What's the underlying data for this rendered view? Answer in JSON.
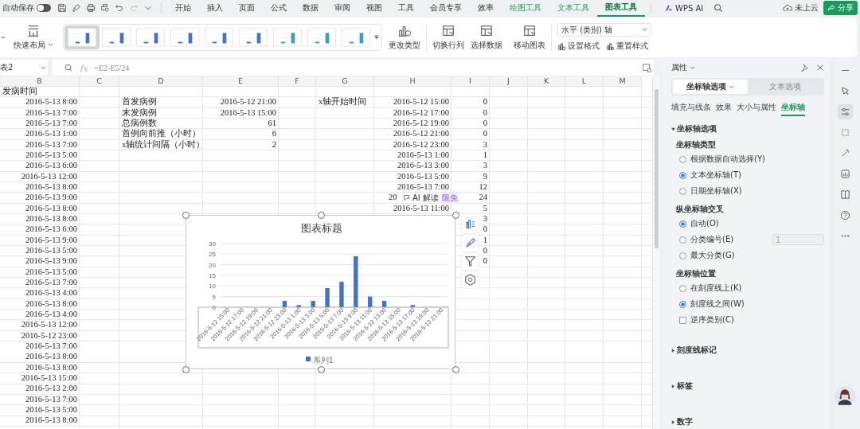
{
  "autosave": {
    "label": "自动保存",
    "on": false
  },
  "menu_tabs": [
    {
      "label": "开始",
      "kind": "normal",
      "selected": false
    },
    {
      "label": "插入",
      "kind": "normal",
      "selected": false
    },
    {
      "label": "页面",
      "kind": "normal",
      "selected": false
    },
    {
      "label": "公式",
      "kind": "normal",
      "selected": false
    },
    {
      "label": "数据",
      "kind": "normal",
      "selected": false
    },
    {
      "label": "审阅",
      "kind": "normal",
      "selected": false
    },
    {
      "label": "视图",
      "kind": "normal",
      "selected": false
    },
    {
      "label": "工具",
      "kind": "normal",
      "selected": false
    },
    {
      "label": "会员专享",
      "kind": "normal",
      "selected": false
    },
    {
      "label": "效率",
      "kind": "normal",
      "selected": false
    },
    {
      "label": "绘图工具",
      "kind": "context",
      "selected": false
    },
    {
      "label": "文本工具",
      "kind": "context",
      "selected": false
    },
    {
      "label": "图表工具",
      "kind": "context",
      "selected": true
    }
  ],
  "ai_tab": "WPS AI",
  "cloud": "未上云",
  "share": "分享",
  "ribbon": {
    "layout": "快速布局",
    "styles": [
      {
        "selected": true
      },
      {
        "selected": false
      },
      {
        "selected": false
      },
      {
        "selected": false
      },
      {
        "selected": false
      },
      {
        "selected": false
      },
      {
        "selected": false
      },
      {
        "selected": false
      },
      {
        "selected": false
      }
    ],
    "change_type": "更改类型",
    "buttons": [
      "切换行列",
      "选择数据",
      "移动图表"
    ],
    "element_select": "水平 (类别) 轴",
    "format": "设置格式",
    "reset": "重置样式"
  },
  "formula_bar": {
    "name_box": "表2",
    "fx_label": "fx",
    "formula": "=E2-E5/24"
  },
  "sheet": {
    "columns": [
      "B",
      "C",
      "D",
      "E",
      "F",
      "G",
      "H",
      "I",
      "J",
      "K",
      "L",
      "M"
    ],
    "rows": [
      {
        "B": {
          "text": "发病时间",
          "kind": "text"
        }
      },
      {
        "B": {
          "text": "2016-5-13 8:00",
          "kind": "number"
        },
        "D": {
          "text": "首发病例",
          "kind": "text"
        },
        "E": {
          "text": "2016-5-12 21:00",
          "kind": "number"
        },
        "G": {
          "text": "x轴开始时间",
          "kind": "text"
        },
        "H": {
          "text": "2016-5-12 15:00",
          "kind": "number"
        },
        "I": {
          "text": "0",
          "kind": "number"
        }
      },
      {
        "B": {
          "text": "2016-5-13 7:00",
          "kind": "number"
        },
        "D": {
          "text": "末发病例",
          "kind": "text"
        },
        "E": {
          "text": "2016-5-13 15:00",
          "kind": "number"
        },
        "H": {
          "text": "2016-5-12 17:00",
          "kind": "number"
        },
        "I": {
          "text": "0",
          "kind": "number"
        }
      },
      {
        "B": {
          "text": "2016-5-13 7:00",
          "kind": "number"
        },
        "D": {
          "text": "总病例数",
          "kind": "text"
        },
        "E": {
          "text": "61",
          "kind": "number"
        },
        "H": {
          "text": "2016-5-12 19:00",
          "kind": "number"
        },
        "I": {
          "text": "0",
          "kind": "number"
        }
      },
      {
        "B": {
          "text": "2016-5-13 1:00",
          "kind": "number"
        },
        "D": {
          "text": "首例向前推（小时）",
          "kind": "text"
        },
        "E": {
          "text": "6",
          "kind": "number"
        },
        "H": {
          "text": "2016-5-12 21:00",
          "kind": "number"
        },
        "I": {
          "text": "0",
          "kind": "number"
        }
      },
      {
        "B": {
          "text": "2016-5-13 7:00",
          "kind": "number"
        },
        "D": {
          "text": "x轴统计间隔（小时）",
          "kind": "text"
        },
        "E": {
          "text": "2",
          "kind": "number"
        },
        "H": {
          "text": "2016-5-12 23:00",
          "kind": "number"
        },
        "I": {
          "text": "3",
          "kind": "number"
        }
      },
      {
        "B": {
          "text": "2016-5-13 5:00",
          "kind": "number"
        },
        "H": {
          "text": "2016-5-13 1:00",
          "kind": "number"
        },
        "I": {
          "text": "1",
          "kind": "number"
        }
      },
      {
        "B": {
          "text": "2016-5-13 6:00",
          "kind": "number"
        },
        "H": {
          "text": "2016-5-13 3:00",
          "kind": "number"
        },
        "I": {
          "text": "3",
          "kind": "number"
        }
      },
      {
        "B": {
          "text": "2016-5-13 12:00",
          "kind": "number"
        },
        "H": {
          "text": "2016-5-13 5:00",
          "kind": "number"
        },
        "I": {
          "text": "9",
          "kind": "number"
        }
      },
      {
        "B": {
          "text": "2016-5-13 8:00",
          "kind": "number"
        },
        "H": {
          "text": "2016-5-13 7:00",
          "kind": "number"
        },
        "I": {
          "text": "12",
          "kind": "number"
        }
      },
      {
        "B": {
          "text": "2016-5-13 9:00",
          "kind": "number"
        },
        "H": {
          "text": "20",
          "kind": "covered"
        },
        "I": {
          "text": "24",
          "kind": "number"
        }
      },
      {
        "B": {
          "text": "2016-5-13 8:00",
          "kind": "number"
        },
        "H": {
          "text": "2016-5-13 11:00",
          "kind": "number"
        },
        "I": {
          "text": "5",
          "kind": "number"
        }
      },
      {
        "B": {
          "text": "2016-5-13 8:00",
          "kind": "number"
        },
        "I": {
          "text": "3",
          "kind": "number"
        }
      },
      {
        "B": {
          "text": "2016-5-13 6:00",
          "kind": "number"
        },
        "I": {
          "text": "0",
          "kind": "number"
        }
      },
      {
        "B": {
          "text": "2016-5-13 9:00",
          "kind": "number"
        },
        "I": {
          "text": "1",
          "kind": "number"
        }
      },
      {
        "B": {
          "text": "2016-5-13 5:00",
          "kind": "number"
        },
        "I": {
          "text": "0",
          "kind": "number"
        }
      },
      {
        "B": {
          "text": "2016-5-13 9:00",
          "kind": "number"
        },
        "I": {
          "text": "0",
          "kind": "number"
        }
      },
      {
        "B": {
          "text": "2016-5-13 5:00",
          "kind": "number"
        }
      },
      {
        "B": {
          "text": "2016-5-13 7:00",
          "kind": "number"
        }
      },
      {
        "B": {
          "text": "2016-5-13 4:00",
          "kind": "number"
        }
      },
      {
        "B": {
          "text": "2016-5-13 8:00",
          "kind": "number"
        }
      },
      {
        "B": {
          "text": "2016-5-13 4:00",
          "kind": "number"
        }
      },
      {
        "B": {
          "text": "2016-5-13 12:00",
          "kind": "number"
        }
      },
      {
        "B": {
          "text": "2016-5-12 23:00",
          "kind": "number"
        }
      },
      {
        "B": {
          "text": "2016-5-13 7:00",
          "kind": "number"
        }
      },
      {
        "B": {
          "text": "2016-5-13 8:00",
          "kind": "number"
        }
      },
      {
        "B": {
          "text": "2016-5-13 8:00",
          "kind": "number"
        }
      },
      {
        "B": {
          "text": "2016-5-13 15:00",
          "kind": "number"
        }
      },
      {
        "B": {
          "text": "2016-5-13 2:00",
          "kind": "number"
        }
      },
      {
        "B": {
          "text": "2016-5-13 7:00",
          "kind": "number"
        }
      },
      {
        "B": {
          "text": "2016-5-13 5:00",
          "kind": "number"
        }
      },
      {
        "B": {
          "text": "2016-5-13 8:00",
          "kind": "number"
        }
      }
    ]
  },
  "ai_popup": {
    "label": "AI 解读",
    "badge": "限免"
  },
  "chart": {
    "chart_data": {
      "type": "bar",
      "title": "图表标题",
      "categories": [
        "2016-5-12 15:00",
        "2016-5-12 17:00",
        "2016-5-12 19:00",
        "2016-5-12 21:00",
        "2016-5-12 23:00",
        "2016-5-13 1:00",
        "2016-5-13 3:00",
        "2016-5-13 5:00",
        "2016-5-13 7:00",
        "2016-5-13 9:00",
        "2016-5-13 11:00",
        "2016-5-13 13:00",
        "2016-5-13 15:00",
        "2016-5-13 17:00",
        "2016-5-13 19:00",
        "2016-5-13 21:00"
      ],
      "series": [
        {
          "name": "系列1",
          "color": "#4472c4",
          "values": [
            0,
            0,
            0,
            0,
            3,
            1,
            3,
            9,
            12,
            24,
            5,
            3,
            0,
            1,
            0,
            0
          ]
        }
      ],
      "ylim": [
        0,
        30
      ],
      "yticks": [
        0,
        5,
        10,
        15,
        20,
        25,
        30
      ],
      "grid": true
    }
  },
  "panel": {
    "title": "属性",
    "tabs": [
      {
        "label": "坐标轴选项",
        "selected": true
      },
      {
        "label": "文本选项",
        "selected": false
      }
    ],
    "subtabs": [
      {
        "label": "填充与线条",
        "selected": false
      },
      {
        "label": "效果",
        "selected": false
      },
      {
        "label": "大小与属性",
        "selected": false
      },
      {
        "label": "坐标轴",
        "selected": true
      }
    ],
    "section": {
      "title": "坐标轴选项",
      "expanded": true,
      "groups": [
        {
          "title": "坐标轴类型",
          "options": [
            {
              "kind": "radio",
              "label": "根据数据自动选择(Y)",
              "selected": false
            },
            {
              "kind": "radio",
              "label": "文本坐标轴(T)",
              "selected": true
            },
            {
              "kind": "radio",
              "label": "日期坐标轴(X)",
              "selected": false
            }
          ]
        },
        {
          "title": "纵坐标轴交叉",
          "options": [
            {
              "kind": "radio",
              "label": "自动(O)",
              "selected": true
            },
            {
              "kind": "radio",
              "label": "分类编号(E)",
              "selected": false,
              "field": {
                "value": "1",
                "disabled": true
              }
            },
            {
              "kind": "radio",
              "label": "最大分类(G)",
              "selected": false
            }
          ]
        },
        {
          "title": "坐标轴位置",
          "options": [
            {
              "kind": "radio",
              "label": "在刻度线上(K)",
              "selected": false
            },
            {
              "kind": "radio",
              "label": "刻度线之间(W)",
              "selected": true
            },
            {
              "kind": "checkbox",
              "label": "逆序类别(C)",
              "checked": false
            }
          ]
        }
      ]
    },
    "collapsed": [
      {
        "title": "刻度线标记",
        "expanded": false
      },
      {
        "title": "标签",
        "expanded": false
      },
      {
        "title": "数字",
        "expanded": false
      }
    ]
  }
}
